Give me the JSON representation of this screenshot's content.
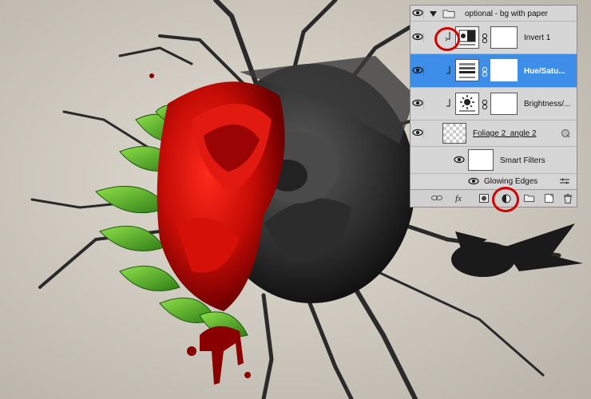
{
  "layers_panel": {
    "group_name": "optional - bg with paper",
    "layers": [
      {
        "name": "Invert 1"
      },
      {
        "name": "Hue/Satu..."
      },
      {
        "name": "Brightness/..."
      },
      {
        "name": "Foliage 2_angle 2"
      },
      {
        "name": "Smart Filters"
      },
      {
        "name": "Glowing Edges"
      }
    ],
    "footer_icons": [
      "link-icon",
      "fx-icon",
      "mask-icon",
      "adjustment-layer-icon",
      "folder-icon",
      "new-layer-icon",
      "trash-icon"
    ]
  },
  "colors": {
    "selected_row": "#3d8ee8",
    "highlight_circle": "#d40000"
  }
}
